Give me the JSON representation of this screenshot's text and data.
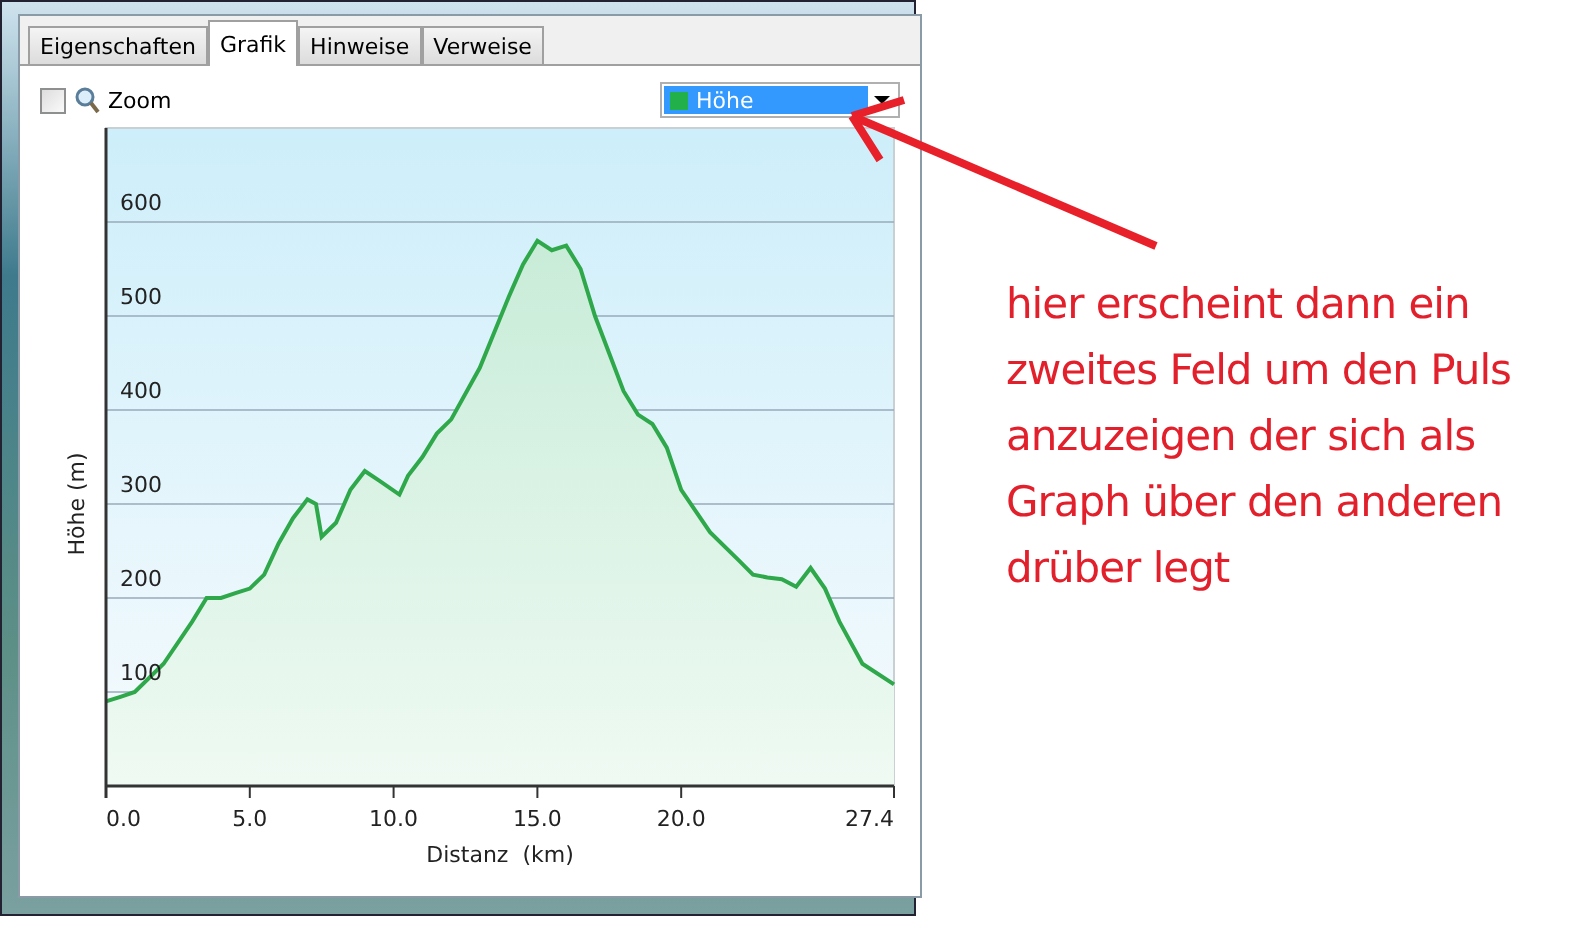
{
  "tabs": [
    {
      "label": "Eigenschaften",
      "selected": false
    },
    {
      "label": "Grafik",
      "selected": true
    },
    {
      "label": "Hinweise",
      "selected": false
    },
    {
      "label": "Verweise",
      "selected": false
    }
  ],
  "toolbar": {
    "zoom": {
      "label": "Zoom",
      "checked": false
    },
    "series_select": {
      "value": "Höhe",
      "color": "#22b04a"
    }
  },
  "chart_data": {
    "type": "area",
    "xlabel": "Distanz  (km)",
    "ylabel": "Höhe (m)",
    "xlim": [
      0,
      27.4
    ],
    "ylim": [
      0,
      700
    ],
    "xticks": [
      {
        "value": 0,
        "label": "0.0"
      },
      {
        "value": 5,
        "label": "5.0"
      },
      {
        "value": 10,
        "label": "10.0"
      },
      {
        "value": 15,
        "label": "15.0"
      },
      {
        "value": 20,
        "label": "20.0"
      },
      {
        "value": 27.4,
        "label": "27.4"
      }
    ],
    "yticks": [
      100,
      200,
      300,
      400,
      500,
      600
    ],
    "grid": true,
    "x": [
      0,
      0.5,
      1,
      2,
      3,
      3.5,
      4,
      4.5,
      5,
      5.5,
      6,
      6.5,
      7,
      7.3,
      7.5,
      8,
      8.5,
      9,
      9.5,
      10.2,
      10.5,
      11,
      11.5,
      12,
      13,
      14,
      14.5,
      15,
      15.5,
      16,
      16.5,
      17,
      18,
      18.5,
      19,
      19.5,
      20,
      21,
      22,
      22.5,
      23,
      23.5,
      24,
      24.5,
      25,
      25.5,
      26.3,
      27.4
    ],
    "series": [
      {
        "color": "#2ea84a",
        "values": [
          90,
          95,
          100,
          130,
          175,
          200,
          200,
          205,
          210,
          225,
          258,
          285,
          305,
          300,
          265,
          280,
          315,
          335,
          325,
          310,
          330,
          350,
          375,
          390,
          445,
          520,
          555,
          580,
          570,
          575,
          550,
          500,
          420,
          395,
          385,
          360,
          315,
          270,
          240,
          225,
          222,
          220,
          212,
          232,
          210,
          175,
          130,
          108
        ]
      }
    ]
  },
  "annotation": {
    "text": "hier erscheint dann ein zweites Feld um den Puls anzuzeigen der sich als Graph über den anderen drüber legt"
  }
}
